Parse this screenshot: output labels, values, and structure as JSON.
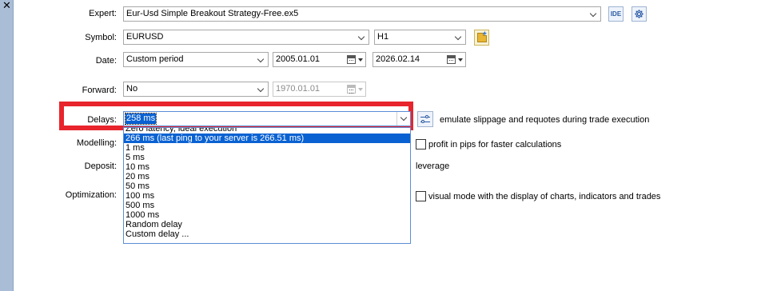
{
  "window": {
    "close_glyph": "✕"
  },
  "labels": {
    "expert": "Expert:",
    "symbol": "Symbol:",
    "date": "Date:",
    "forward": "Forward:",
    "delays": "Delays:",
    "modelling": "Modelling:",
    "deposit": "Deposit:",
    "optimization": "Optimization:"
  },
  "expert": {
    "value": "Eur-Usd Simple Breakout Strategy-Free.ex5",
    "ide_label": "IDE"
  },
  "symbol": {
    "value": "EURUSD",
    "timeframe": "H1"
  },
  "date": {
    "mode": "Custom period",
    "from": "2005.01.01",
    "to": "2026.02.14"
  },
  "forward": {
    "mode": "No",
    "date": "1970.01.01"
  },
  "delays": {
    "selected": "258 ms",
    "hint": "emulate slippage and requotes during trade execution",
    "options": [
      "Zero latency, ideal execution",
      "266 ms (last ping to your server is 266.51 ms)",
      "1 ms",
      "5 ms",
      "10 ms",
      "20 ms",
      "50 ms",
      "100 ms",
      "500 ms",
      "1000 ms",
      "Random delay",
      "Custom delay ..."
    ],
    "highlighted_index": 1
  },
  "options": {
    "profit_in_pips": "profit in pips for faster calculations",
    "leverage": "leverage",
    "visual_mode": "visual mode with the display of charts, indicators and trades"
  },
  "colors": {
    "sidebar": "#a9bdd7",
    "highlight": "#0a62d2",
    "annotation_box": "#e8242c"
  }
}
